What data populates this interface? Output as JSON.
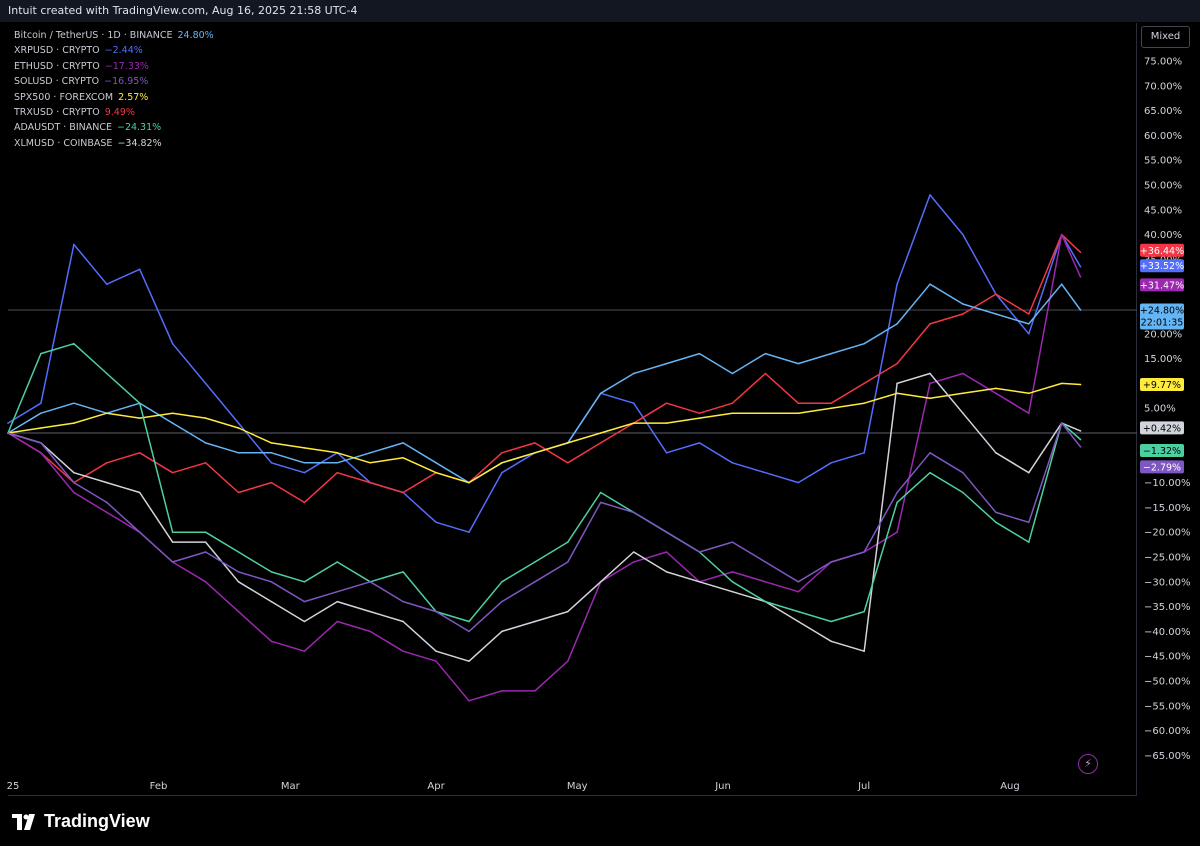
{
  "header": {
    "caption": "Intuit created with TradingView.com, Aug 16, 2025 21:58 UTC-4"
  },
  "toolbar": {
    "scale_mode": "Mixed"
  },
  "brand": {
    "name": "TradingView"
  },
  "legend": [
    {
      "symbol": "Bitcoin / TetherUS · 1D · BINANCE",
      "change": "24.80%",
      "color": "#64b5f6"
    },
    {
      "symbol": "XRPUSD · CRYPTO",
      "change": "−2.44%",
      "color": "#536dfe"
    },
    {
      "symbol": "ETHUSD · CRYPTO",
      "change": "−17.33%",
      "color": "#9c27b0"
    },
    {
      "symbol": "SOLUSD · CRYPTO",
      "change": "−16.95%",
      "color": "#7e57c2"
    },
    {
      "symbol": "SPX500 · FOREXCOM",
      "change": "2.57%",
      "color": "#ffeb3b"
    },
    {
      "symbol": "TRXUSD · CRYPTO",
      "change": "9.49%",
      "color": "#f23645"
    },
    {
      "symbol": "ADAUSDT · BINANCE",
      "change": "−24.31%",
      "color": "#4dd0a1"
    },
    {
      "symbol": "XLMUSD · COINBASE",
      "change": "−34.82%",
      "color": "#d1d4dc"
    }
  ],
  "chart_data": {
    "type": "line",
    "scale": "percent",
    "ylim": [
      -67,
      80
    ],
    "yticks": [
      "75.00%",
      "70.00%",
      "65.00%",
      "60.00%",
      "55.00%",
      "50.00%",
      "45.00%",
      "40.00%",
      "35.00%",
      "30.00%",
      "25.00%",
      "20.00%",
      "15.00%",
      "10.00%",
      "5.00%",
      "−10.00%",
      "−15.00%",
      "−20.00%",
      "−25.00%",
      "−30.00%",
      "−35.00%",
      "−40.00%",
      "−45.00%",
      "−50.00%",
      "−55.00%",
      "−60.00%",
      "−65.00%"
    ],
    "ytick_values": [
      75,
      70,
      65,
      60,
      55,
      50,
      45,
      40,
      35,
      30,
      25,
      20,
      15,
      10,
      5,
      -10,
      -15,
      -20,
      -25,
      -30,
      -35,
      -40,
      -45,
      -50,
      -55,
      -60,
      -65
    ],
    "xticks": [
      "25",
      "Feb",
      "Mar",
      "Apr",
      "May",
      "Jun",
      "Jul",
      "Aug"
    ],
    "xtick_dates": [
      "2025-01-01",
      "2025-02-01",
      "2025-03-01",
      "2025-04-01",
      "2025-05-01",
      "2025-06-01",
      "2025-07-01",
      "2025-08-01"
    ],
    "x_range": [
      "2024-12-31",
      "2025-08-28"
    ],
    "dates": [
      "2024-12-31",
      "2025-01-07",
      "2025-01-14",
      "2025-01-21",
      "2025-01-28",
      "2025-02-04",
      "2025-02-11",
      "2025-02-18",
      "2025-02-25",
      "2025-03-04",
      "2025-03-11",
      "2025-03-18",
      "2025-03-25",
      "2025-04-01",
      "2025-04-08",
      "2025-04-15",
      "2025-04-22",
      "2025-04-29",
      "2025-05-06",
      "2025-05-13",
      "2025-05-20",
      "2025-05-27",
      "2025-06-03",
      "2025-06-10",
      "2025-06-17",
      "2025-06-24",
      "2025-07-01",
      "2025-07-08",
      "2025-07-15",
      "2025-07-22",
      "2025-07-29",
      "2025-08-05",
      "2025-08-12",
      "2025-08-16"
    ],
    "series": [
      {
        "name": "XRPUSD · CRYPTO",
        "color": "#536dfe",
        "last_label": "+33.52%",
        "values": [
          2,
          6,
          38,
          30,
          33,
          18,
          10,
          2,
          -6,
          -8,
          -4,
          -10,
          -12,
          -18,
          -20,
          -8,
          -4,
          -2,
          8,
          6,
          -4,
          -2,
          -6,
          -8,
          -10,
          -6,
          -4,
          30,
          48,
          40,
          28,
          20,
          40,
          33.52
        ]
      },
      {
        "name": "TRXUSD · CRYPTO",
        "color": "#f23645",
        "last_label": "+36.44%",
        "values": [
          0,
          -4,
          -10,
          -6,
          -4,
          -8,
          -6,
          -12,
          -10,
          -14,
          -8,
          -10,
          -12,
          -8,
          -10,
          -4,
          -2,
          -6,
          -2,
          2,
          6,
          4,
          6,
          12,
          6,
          6,
          10,
          14,
          22,
          24,
          28,
          24,
          40,
          36.44
        ]
      },
      {
        "name": "ETHUSD · CRYPTO",
        "color": "#9c27b0",
        "last_label": "+31.47%",
        "values": [
          0,
          -4,
          -12,
          -16,
          -20,
          -26,
          -30,
          -36,
          -42,
          -44,
          -38,
          -40,
          -44,
          -46,
          -54,
          -52,
          -52,
          -46,
          -30,
          -26,
          -24,
          -30,
          -28,
          -30,
          -32,
          -26,
          -24,
          -20,
          10,
          12,
          8,
          4,
          40,
          31.47
        ]
      },
      {
        "name": "Bitcoin / TetherUS · 1D · BINANCE",
        "color": "#64b5f6",
        "last_label": "+24.80%",
        "values": [
          0,
          4,
          6,
          4,
          6,
          2,
          -2,
          -4,
          -4,
          -6,
          -6,
          -4,
          -2,
          -6,
          -10,
          -6,
          -4,
          -2,
          8,
          12,
          14,
          16,
          12,
          16,
          14,
          16,
          18,
          22,
          30,
          26,
          24,
          22,
          30,
          24.8
        ]
      },
      {
        "name": "SPX500 · FOREXCOM",
        "color": "#ffeb3b",
        "last_label": "+9.77%",
        "values": [
          0,
          1,
          2,
          4,
          3,
          4,
          3,
          1,
          -2,
          -3,
          -4,
          -6,
          -5,
          -8,
          -10,
          -6,
          -4,
          -2,
          0,
          2,
          2,
          3,
          4,
          4,
          4,
          5,
          6,
          8,
          7,
          8,
          9,
          8,
          10,
          9.77
        ]
      },
      {
        "name": "XLMUSD · COINBASE",
        "color": "#d1d4dc",
        "last_label": "+0.42%",
        "values": [
          0,
          -2,
          -8,
          -10,
          -12,
          -22,
          -22,
          -30,
          -34,
          -38,
          -34,
          -36,
          -38,
          -44,
          -46,
          -40,
          -38,
          -36,
          -30,
          -24,
          -28,
          -30,
          -32,
          -34,
          -38,
          -42,
          -44,
          10,
          12,
          4,
          -4,
          -8,
          2,
          0.42
        ]
      },
      {
        "name": "ADAUSDT · BINANCE",
        "color": "#4dd0a1",
        "last_label": "−1.32%",
        "values": [
          0,
          16,
          18,
          12,
          6,
          -20,
          -20,
          -24,
          -28,
          -30,
          -26,
          -30,
          -28,
          -36,
          -38,
          -30,
          -26,
          -22,
          -12,
          -16,
          -20,
          -24,
          -30,
          -34,
          -36,
          -38,
          -36,
          -14,
          -8,
          -12,
          -18,
          -22,
          2,
          -1.32
        ]
      },
      {
        "name": "SOLUSD · CRYPTO",
        "color": "#7e57c2",
        "last_label": "−2.79%",
        "values": [
          0,
          -2,
          -10,
          -14,
          -20,
          -26,
          -24,
          -28,
          -30,
          -34,
          -32,
          -30,
          -34,
          -36,
          -40,
          -34,
          -30,
          -26,
          -14,
          -16,
          -20,
          -24,
          -22,
          -26,
          -30,
          -26,
          -24,
          -12,
          -4,
          -8,
          -16,
          -18,
          2,
          -2.79
        ]
      }
    ],
    "price_tag": {
      "value_label": "+24.80%",
      "time_label": "22:01:35"
    }
  }
}
